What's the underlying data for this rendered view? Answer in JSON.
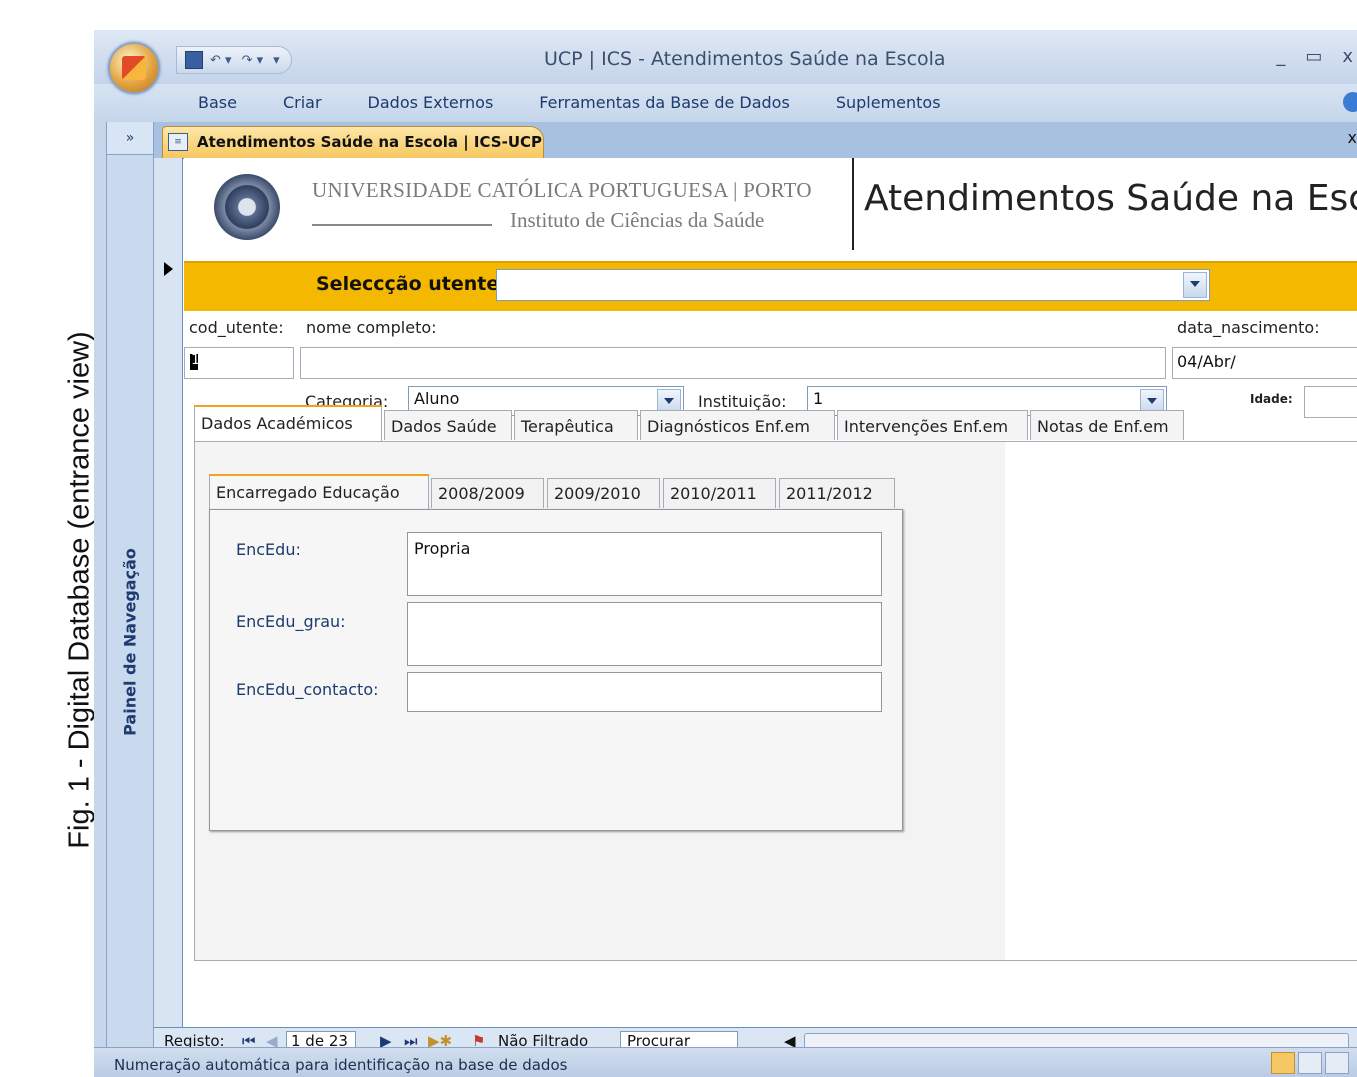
{
  "caption": "Fig. 1  -  Digital Database (entrance view)",
  "window": {
    "title": "UCP | ICS - Atendimentos Saúde na Escola",
    "controls": {
      "minimize": "_",
      "maximize": "▭",
      "close": "x"
    }
  },
  "ribbon": {
    "tabs": [
      "Base",
      "Criar",
      "Dados Externos",
      "Ferramentas da Base de Dados",
      "Suplementos"
    ]
  },
  "nav_pane": {
    "toggle": "»",
    "label": "Painel de Navegação"
  },
  "document_tab": {
    "label": "Atendimentos Saúde na Escola | ICS-UCP",
    "close": "x"
  },
  "header": {
    "university_line1": "UNIVERSIDADE CATÓLICA PORTUGUESA | PORTO",
    "university_line2": "Instituto de Ciências da Saúde",
    "app_title": "Atendimentos Saúde na Escola"
  },
  "selection": {
    "label": "Seleccção utente",
    "value": ""
  },
  "fields": {
    "cod_utente_label": "cod_utente:",
    "cod_utente_value": "1",
    "nome_label": "nome completo:",
    "nome_value": "",
    "data_nascimento_label": "data_nascimento:",
    "data_nascimento_value": "04/Abr/",
    "categoria_label": "Categoria:",
    "categoria_value": "Aluno",
    "instituicao_label": "Instituição:",
    "instituicao_value": "1",
    "idade_label": "Idade:",
    "idade_value": ""
  },
  "main_tabs": [
    "Dados Académicos",
    "Dados Saúde",
    "Terapêutica",
    "Diagnósticos Enf.em",
    "Intervenções Enf.em",
    "Notas de Enf.em"
  ],
  "sub_tabs": [
    "Encarregado Educação",
    "2008/2009",
    "2009/2010",
    "2010/2011",
    "2011/2012"
  ],
  "encarregado": {
    "encedu_label": "EncEdu:",
    "encedu_value": "Propria",
    "grau_label": "EncEdu_grau:",
    "grau_value": "",
    "contacto_label": "EncEdu_contacto:",
    "contacto_value": ""
  },
  "record_nav": {
    "label": "Registo:",
    "current": "1 de 23",
    "filter": "Não Filtrado",
    "search": "Procurar"
  },
  "status_bar": {
    "text": "Numeração automática para identificação na base de dados"
  }
}
